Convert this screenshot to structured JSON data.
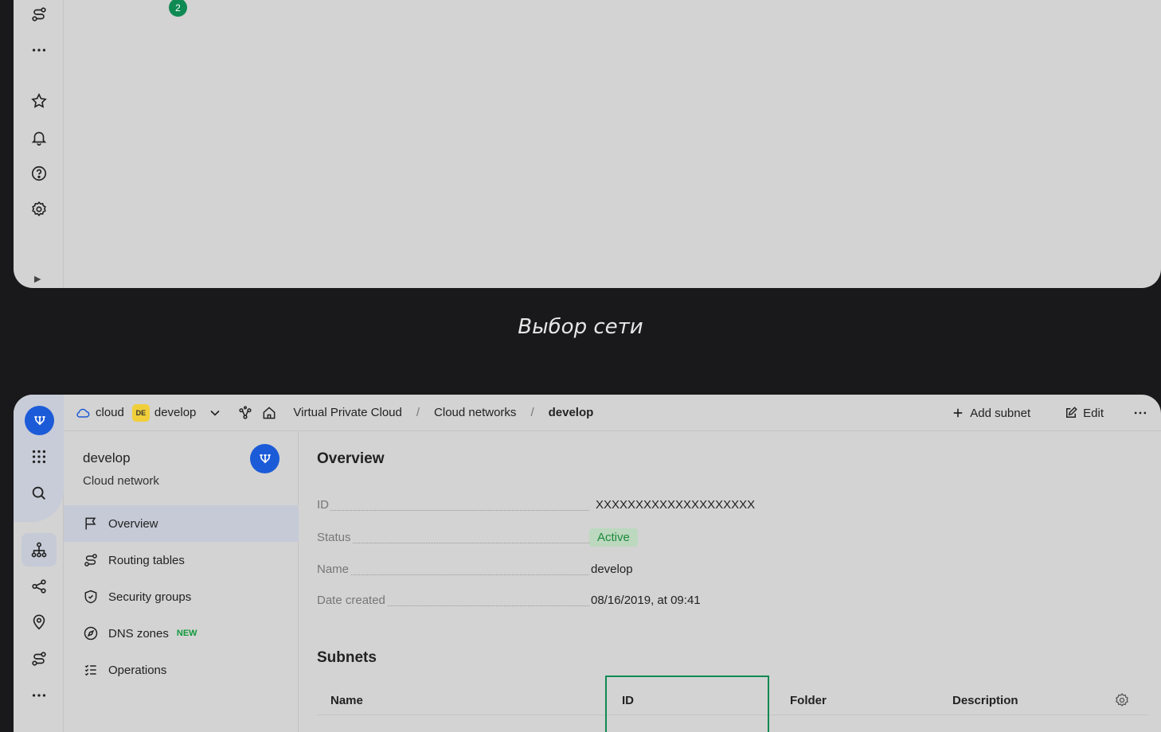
{
  "top_window": {
    "badge_count": "2"
  },
  "caption": "Выбор сети",
  "header": {
    "cloud": "cloud",
    "folder_badge": "DE",
    "folder": "develop",
    "breadcrumbs": [
      "Virtual Private Cloud",
      "Cloud networks",
      "develop"
    ],
    "add_subnet": "Add subnet",
    "edit": "Edit"
  },
  "sidebar": {
    "title": "develop",
    "subtitle": "Cloud network",
    "items": [
      {
        "label": "Overview",
        "icon": "flag-icon"
      },
      {
        "label": "Routing tables",
        "icon": "route-icon"
      },
      {
        "label": "Security groups",
        "icon": "shield-icon"
      },
      {
        "label": "DNS zones",
        "icon": "compass-icon",
        "tag": "NEW"
      },
      {
        "label": "Operations",
        "icon": "list-icon"
      }
    ]
  },
  "overview": {
    "heading": "Overview",
    "fields": [
      {
        "key": "ID",
        "value": "XXXXXXXXXXXXXXXXXXXX"
      },
      {
        "key": "Status",
        "value": "Active"
      },
      {
        "key": "Name",
        "value": "develop"
      },
      {
        "key": "Date created",
        "value": "08/16/2019, at 09:41"
      }
    ]
  },
  "subnets": {
    "heading": "Subnets",
    "columns": [
      "Name",
      "ID",
      "Folder",
      "Description"
    ]
  },
  "colors": {
    "accent": "#1c5bd8",
    "success": "#0f8a53",
    "highlight": "#0f8a53"
  }
}
